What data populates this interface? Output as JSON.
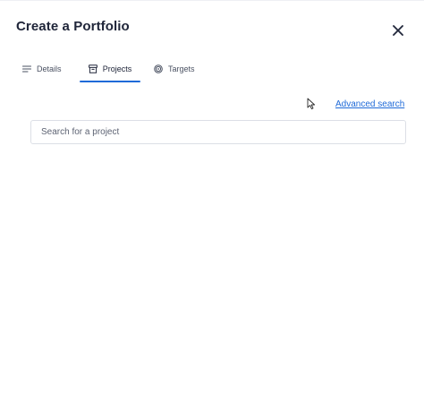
{
  "dialog": {
    "title": "Create a Portfolio"
  },
  "tabs": [
    {
      "label": "Details",
      "icon": "lines-icon",
      "active": false
    },
    {
      "label": "Projects",
      "icon": "archive-box-icon",
      "active": true
    },
    {
      "label": "Targets",
      "icon": "target-icon",
      "active": false
    }
  ],
  "search": {
    "advanced_link": "Advanced search",
    "placeholder": "Search for a project",
    "value": ""
  },
  "colors": {
    "accent": "#1f6ad8",
    "title": "#20263a",
    "border": "#dcdfe6"
  }
}
